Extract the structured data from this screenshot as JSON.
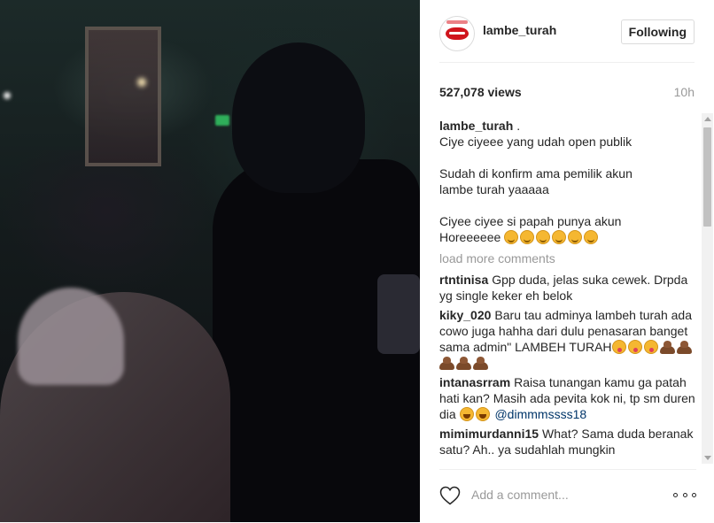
{
  "post": {
    "username": "lambe_turah",
    "follow_label": "Following",
    "views": "527,078 views",
    "time": "10h"
  },
  "caption": {
    "username": "lambe_turah",
    "lines": [
      ".",
      "Ciye ciyeee yang udah open publik",
      "",
      "Sudah di konfirm ama pemilik akun",
      "lambe turah yaaaaa",
      "",
      "Ciyee ciyee si papah punya akun",
      "Horeeeeee"
    ],
    "emojis": [
      "smiling-face",
      "smiling-face",
      "smiling-face",
      "smiling-face",
      "smiling-face",
      "smiling-face"
    ]
  },
  "load_more": "load more comments",
  "comments": [
    {
      "user": "rtntinisa",
      "text": "Gpp duda, jelas suka cewek. Drpda yg single keker eh belok"
    },
    {
      "user": "kiky_020",
      "text": "Baru tau adminya lambeh turah ada cowo juga hahha dari dulu penasaran banget sama admin\" LAMBEH TURAH",
      "emojis": [
        "tongue-face",
        "tongue-face",
        "tongue-face",
        "poop",
        "poop",
        "poop",
        "poop",
        "poop"
      ]
    },
    {
      "user": "intanasrram",
      "text": "Raisa tunangan kamu ga patah hati kan? Masih ada pevita kok ni, tp sm duren dia",
      "emojis": [
        "laughing-face",
        "laughing-face"
      ],
      "mention": "@dimmmssss18"
    },
    {
      "user": "mimimurdanni15",
      "text": "What? Sama duda beranak satu? Ah.. ya sudahlah mungkin"
    }
  ],
  "footer": {
    "comment_placeholder": "Add a comment..."
  }
}
